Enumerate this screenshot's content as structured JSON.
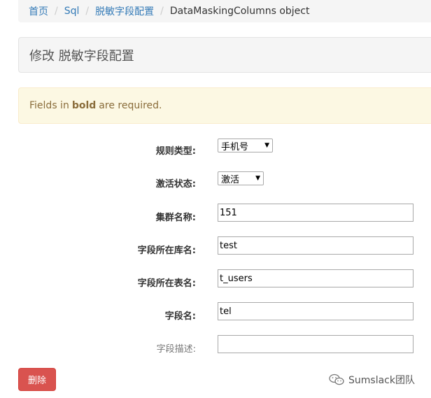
{
  "breadcrumb": {
    "home": "首页",
    "app": "Sql",
    "model": "脱敏字段配置",
    "current": "DataMaskingColumns object"
  },
  "page_title": "修改 脱敏字段配置",
  "alert": {
    "prefix": "Fields in",
    "bold": "bold",
    "suffix": "are required."
  },
  "form": {
    "rule_type_label": "规则类型:",
    "rule_type_value": "手机号",
    "active_label": "激活状态:",
    "active_value": "激活",
    "cluster_label": "集群名称:",
    "cluster_value": "151",
    "db_label": "字段所在库名:",
    "db_value": "test",
    "table_label": "字段所在表名:",
    "table_value": "t_users",
    "column_label": "字段名:",
    "column_value": "tel",
    "comment_label": "字段描述:",
    "comment_value": ""
  },
  "actions": {
    "delete_label": "删除"
  },
  "watermark": {
    "text": "Sumslack团队",
    "icon": "wechat-icon"
  }
}
